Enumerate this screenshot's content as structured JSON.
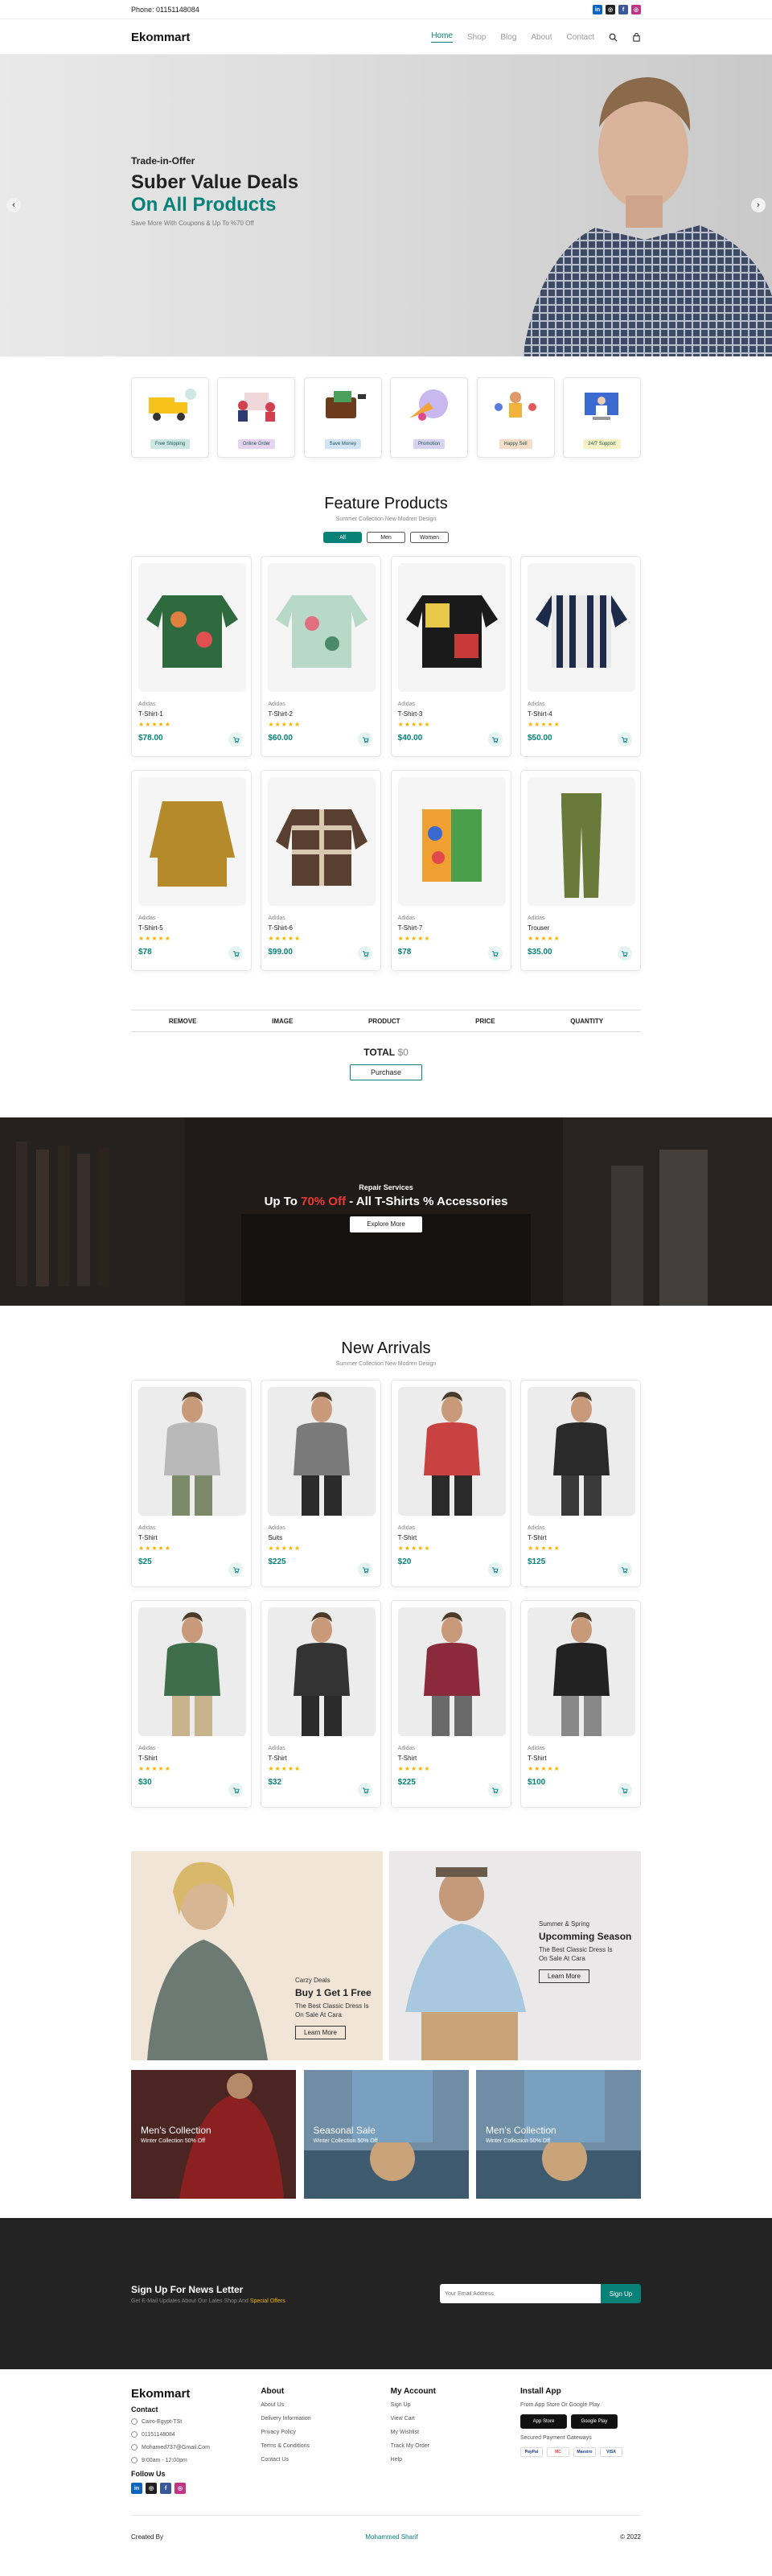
{
  "topbar": {
    "phone": "Phone: 01151148084",
    "social": [
      "in",
      "ig",
      "f",
      "ig"
    ]
  },
  "nav": {
    "logo": "Ekommart",
    "items": [
      "Home",
      "Shop",
      "Blog",
      "About",
      "Contact"
    ]
  },
  "hero": {
    "kicker": "Trade-in-Offer",
    "title1": "Suber Value Deals",
    "title2": "On All Products",
    "desc": "Save More With Coupons & Up To %70 Off",
    "prev": "‹",
    "next": "›"
  },
  "features": [
    {
      "label": "Free Shipping",
      "color": "#cde6e1"
    },
    {
      "label": "Online Order",
      "color": "#e7d2f0"
    },
    {
      "label": "Save Money",
      "color": "#d1e3f5"
    },
    {
      "label": "Promotion",
      "color": "#d7d2f0"
    },
    {
      "label": "Happy Sell",
      "color": "#f6dbc6"
    },
    {
      "label": "24/7 Support",
      "color": "#f7f1c6"
    }
  ],
  "featured": {
    "title": "Feature Products",
    "subtitle": "Summer Collection New Modren Design",
    "filters": [
      "All",
      "Men",
      "Women"
    ],
    "products": [
      {
        "brand": "Adidas",
        "name": "T-Shirt-1",
        "price": "$78.00"
      },
      {
        "brand": "Adidas",
        "name": "T-Shirt-2",
        "price": "$60.00"
      },
      {
        "brand": "Adidas",
        "name": "T-Shirt-3",
        "price": "$40.00"
      },
      {
        "brand": "Adidas",
        "name": "T-Shirt-4",
        "price": "$50.00"
      },
      {
        "brand": "Adidas",
        "name": "T-Shirt-5",
        "price": "$78"
      },
      {
        "brand": "Adidas",
        "name": "T-Shirt-6",
        "price": "$99.00"
      },
      {
        "brand": "Adidas",
        "name": "T-Shirt-7",
        "price": "$78"
      },
      {
        "brand": "Adidas",
        "name": "Trouser",
        "price": "$35.00"
      }
    ]
  },
  "cart": {
    "headers": [
      "REMOVE",
      "IMAGE",
      "PRODUCT",
      "PRICE",
      "QUANTITY"
    ],
    "total_label": "TOTAL",
    "total_value": "$0",
    "purchase": "Purchase"
  },
  "banner": {
    "kicker": "Repair Services",
    "pre": "Up To ",
    "highlight": "70% Off",
    "post": " - All T-Shirts % Accessories",
    "button": "Explore More"
  },
  "arrivals": {
    "title": "New Arrivals",
    "subtitle": "Summer Collection New Modren Design",
    "products": [
      {
        "brand": "Adidas",
        "name": "T-Shirt",
        "price": "$25",
        "shirt": "#b9b9b9",
        "pants": "#7c8a6a"
      },
      {
        "brand": "Adidas",
        "name": "Suits",
        "price": "$225",
        "shirt": "#7a7a7a",
        "pants": "#2b2b2b"
      },
      {
        "brand": "Adidas",
        "name": "T-Shirt",
        "price": "$20",
        "shirt": "#c84242",
        "pants": "#2a2a2a"
      },
      {
        "brand": "Adidas",
        "name": "T-Shirt",
        "price": "$125",
        "shirt": "#2a2a2a",
        "pants": "#3a3a3a"
      },
      {
        "brand": "Adidas",
        "name": "T-Shirt",
        "price": "$30",
        "shirt": "#3f6e4d",
        "pants": "#c7b48c"
      },
      {
        "brand": "Adidas",
        "name": "T-Shirt",
        "price": "$32",
        "shirt": "#333333",
        "pants": "#2b2b2b"
      },
      {
        "brand": "Adidas",
        "name": "T-Shirt",
        "price": "$225",
        "shirt": "#8a2a3a",
        "pants": "#6a6a6a"
      },
      {
        "brand": "Adidas",
        "name": "T-Shirt",
        "price": "$100",
        "shirt": "#222222",
        "pants": "#888888"
      }
    ]
  },
  "promo": {
    "left": {
      "small": "Carzy Deals",
      "big": "Buy 1 Get 1 Free",
      "desc": "The Best Classic Dress Is On Sale At Cara",
      "button": "Learn More"
    },
    "right": {
      "small": "Summer & Spring",
      "big": "Upcomming Season",
      "desc": "The Best Classic Dress Is On Sale At Cara",
      "button": "Learn More"
    }
  },
  "collections": [
    {
      "title": "Men's Collection",
      "sub": "Winter Collection 50% Off"
    },
    {
      "title": "Seasonal Sale",
      "sub": "Winter Collection 50% Off"
    },
    {
      "title": "Men's Collection",
      "sub": "Winter Collection 50% Off"
    }
  ],
  "newsletter": {
    "title": "Sign Up For News Letter",
    "desc_pre": "Get E-Mail Updates About Our Lates Shop And ",
    "desc_highlight": "Special Offers",
    "placeholder": "Your Email Address",
    "button": "Sign Up"
  },
  "footer": {
    "logo": "Ekommart",
    "contact_title": "Contact",
    "contact": [
      "Cairo-Egypt-TSt",
      "01151148084",
      "Mohamed737@Gmail.Com",
      "9:00am - 12:00pm"
    ],
    "follow": "Follow Us",
    "about_title": "About",
    "about": [
      "About Us",
      "Delivery Information",
      "Privacy Policy",
      "Terms & Conditions",
      "Contact Us"
    ],
    "account_title": "My Account",
    "account": [
      "Sign Up",
      "View Cart",
      "My Wishlist",
      "Track My Order",
      "Help"
    ],
    "app_title": "Install App",
    "app_desc": "From App Store Or Google Play",
    "stores": [
      "App Store",
      "Google Play"
    ],
    "pay_title": "Secured Payment Gateways",
    "pays": [
      "PayPal",
      "MC",
      "Maestro",
      "VISA"
    ],
    "credit_pre": "Created By ",
    "credit_name": "Mohammed Sharif",
    "credit_post": " © 2022"
  }
}
